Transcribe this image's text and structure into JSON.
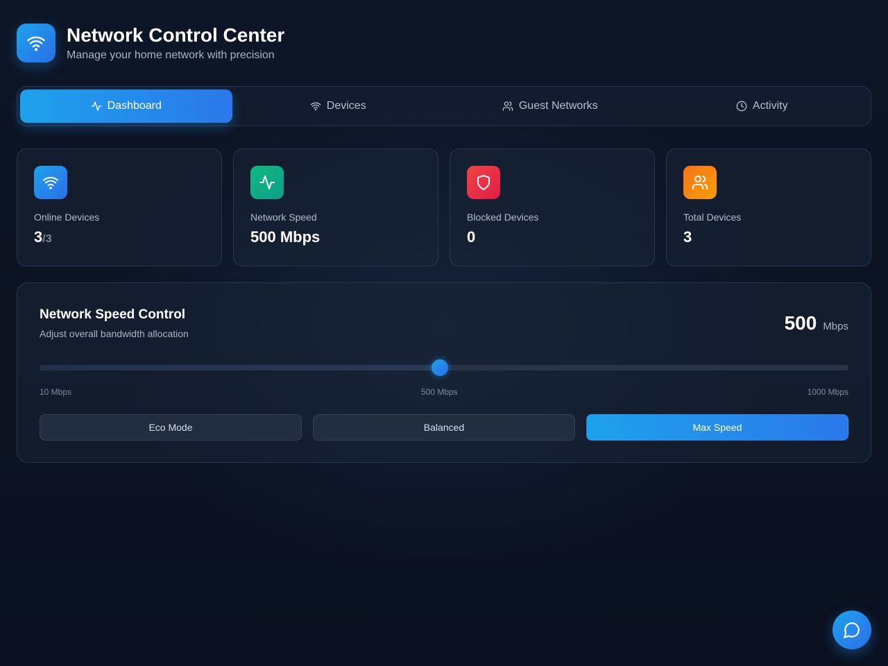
{
  "header": {
    "title": "Network Control Center",
    "subtitle": "Manage your home network with precision",
    "logo_icon": "wifi-icon"
  },
  "tabs": [
    {
      "label": "Dashboard",
      "icon": "activity-icon",
      "active": true
    },
    {
      "label": "Devices",
      "icon": "wifi-icon",
      "active": false
    },
    {
      "label": "Guest Networks",
      "icon": "users-icon",
      "active": false
    },
    {
      "label": "Activity",
      "icon": "clock-icon",
      "active": false
    }
  ],
  "stats": [
    {
      "label": "Online Devices",
      "value": "3",
      "of": "/3",
      "icon": "wifi-icon",
      "color": "#1ea2ec"
    },
    {
      "label": "Network Speed",
      "value": "500 Mbps",
      "icon": "activity-icon",
      "color": "#10b981"
    },
    {
      "label": "Blocked Devices",
      "value": "0",
      "icon": "shield-icon",
      "color": "#ef4444"
    },
    {
      "label": "Total Devices",
      "value": "3",
      "icon": "users-icon",
      "color": "#f97316"
    }
  ],
  "speed_control": {
    "title": "Network Speed Control",
    "subtitle": "Adjust overall bandwidth allocation",
    "current_value": "500",
    "unit": "Mbps",
    "min": 10,
    "max": 1000,
    "value": 500,
    "tick_labels": [
      "10 Mbps",
      "500 Mbps",
      "1000 Mbps"
    ],
    "modes": [
      {
        "label": "Eco Mode",
        "active": false
      },
      {
        "label": "Balanced",
        "active": false
      },
      {
        "label": "Max Speed",
        "active": true
      }
    ]
  },
  "chat_button": {
    "icon": "chat-icon"
  },
  "colors": {
    "accent": "#1ea2ec",
    "background": "#0c1424"
  }
}
